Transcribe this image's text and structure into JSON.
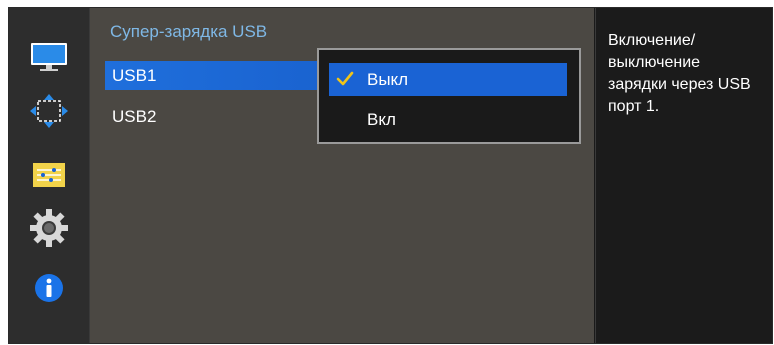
{
  "sidebar": {
    "items": [
      {
        "icon": "monitor-icon"
      },
      {
        "icon": "resize-arrows-icon"
      },
      {
        "icon": "sliders-icon"
      },
      {
        "icon": "gear-icon"
      },
      {
        "icon": "info-icon"
      }
    ]
  },
  "menu": {
    "title": "Супер-зарядка USB",
    "items": [
      {
        "label": "USB1",
        "selected": true
      },
      {
        "label": "USB2",
        "selected": false
      }
    ]
  },
  "dropdown": {
    "options": [
      {
        "label": "Выкл",
        "checked": true
      },
      {
        "label": "Вкл",
        "checked": false
      }
    ]
  },
  "help": {
    "text": "Включение/ выключение зарядки через USB порт 1."
  },
  "colors": {
    "accent": "#1a63d4",
    "title": "#7fb8e6",
    "check": "#f0c419"
  }
}
